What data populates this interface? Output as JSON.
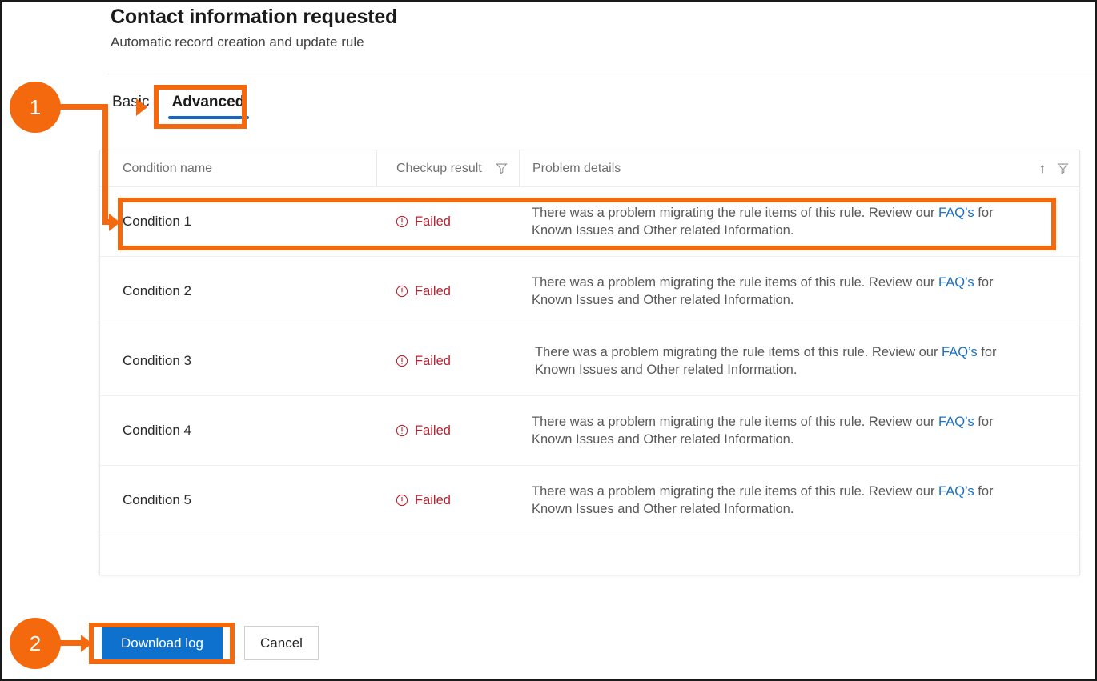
{
  "header": {
    "title": "Contact information requested",
    "subtitle": "Automatic record creation and update rule"
  },
  "tabs": [
    {
      "label": "Basic",
      "active": false
    },
    {
      "label": "Advanced",
      "active": true
    }
  ],
  "table": {
    "columns": {
      "name": "Condition name",
      "result": "Checkup result",
      "details": "Problem details"
    },
    "icons": {
      "filter": "filter-icon",
      "sort_ascending": "sort-ascending-icon",
      "error": "error-circle-icon"
    },
    "rows": [
      {
        "name": "Condition 1",
        "result": "Failed",
        "details_before": "There was a problem migrating the rule items of this rule. Review our ",
        "details_link": "FAQ’s",
        "details_after": " for Known Issues and Other related Information."
      },
      {
        "name": "Condition 2",
        "result": "Failed",
        "details_before": "There was a problem migrating the rule items of this rule. Review our ",
        "details_link": "FAQ’s",
        "details_after": " for Known Issues and Other related Information."
      },
      {
        "name": "Condition 3",
        "result": "Failed",
        "details_before": "There was a problem migrating the rule items of this rule. Review our ",
        "details_link": "FAQ’s",
        "details_after": " for Known Issues and Other related Information."
      },
      {
        "name": "Condition 4",
        "result": "Failed",
        "details_before": "There was a problem migrating the rule items of this rule. Review our ",
        "details_link": "FAQ’s",
        "details_after": " for Known Issues and Other related Information."
      },
      {
        "name": "Condition 5",
        "result": "Failed",
        "details_before": "There was a problem migrating the rule items of this rule. Review our ",
        "details_link": "FAQ’s",
        "details_after": " for Known Issues and Other related Information."
      }
    ]
  },
  "footer": {
    "download_log": "Download log",
    "cancel": "Cancel"
  },
  "annotations": {
    "badge_1": "1",
    "badge_2": "2"
  },
  "colors": {
    "callout_orange": "#f4690d",
    "primary_blue": "#0f71ce",
    "tab_underline_blue": "#1668c8",
    "error_red": "#bb2230",
    "link_blue": "#1b72c2"
  }
}
